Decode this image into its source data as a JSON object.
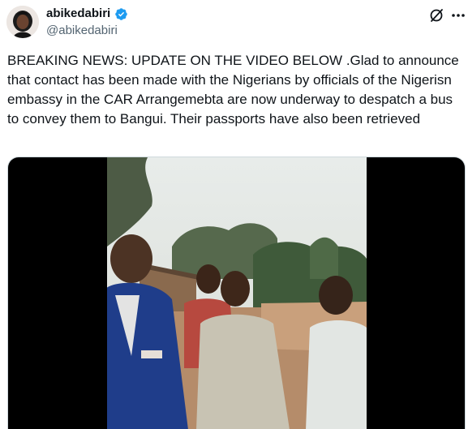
{
  "author": {
    "display_name": "abikedabiri",
    "handle": "@abikedabiri",
    "verified": true,
    "avatar_icon": "profile-photo"
  },
  "actions": {
    "grok_icon": "grok-slash-icon",
    "more_icon": "more-horizontal-icon"
  },
  "tweet": {
    "text": "BREAKING NEWS: UPDATE ON THE VIDEO BELOW .Glad to announce that contact has been made with the Nigerians by officials of the Nigerisn embassy in the CAR Arrangemebta are now underway to despatch a bus to convey them to Bangui. Their passports have also been retrieved"
  },
  "media": {
    "type": "video"
  },
  "colors": {
    "text": "#0f1419",
    "secondary_text": "#536471",
    "verified_blue": "#1d9bf0",
    "media_background": "#000000"
  }
}
